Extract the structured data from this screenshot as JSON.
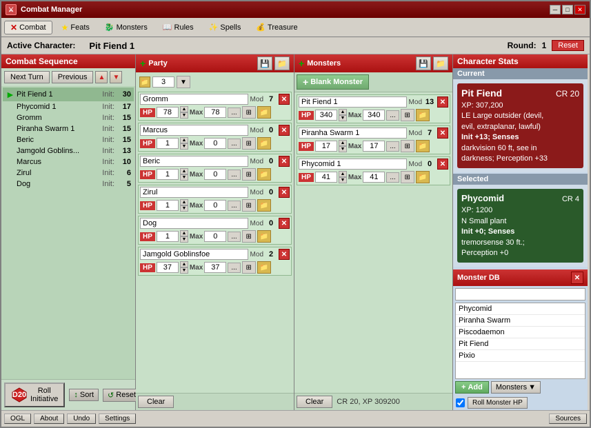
{
  "window": {
    "title": "Combat Manager",
    "close": "✕",
    "minimize": "─",
    "maximize": "□"
  },
  "menu": {
    "items": [
      {
        "id": "combat",
        "label": "Combat",
        "icon": "✕",
        "active": true
      },
      {
        "id": "feats",
        "label": "Feats",
        "icon": "★"
      },
      {
        "id": "monsters",
        "label": "Monsters",
        "icon": "👾"
      },
      {
        "id": "rules",
        "label": "Rules",
        "icon": "📖"
      },
      {
        "id": "spells",
        "label": "Spells",
        "icon": "✨"
      },
      {
        "id": "treasure",
        "label": "Treasure",
        "icon": "💰"
      }
    ]
  },
  "active_character": {
    "label": "Active Character:",
    "name": "Pit Fiend 1",
    "round_label": "Round:",
    "round": "1",
    "reset": "Reset"
  },
  "combat_sequence": {
    "header": "Combat Sequence",
    "next_turn": "Next Turn",
    "previous": "Previous",
    "entries": [
      {
        "name": "Pit Fiend 1",
        "init_label": "Init:",
        "init": 30,
        "active": true
      },
      {
        "name": "Phycomid 1",
        "init_label": "Init:",
        "init": 17,
        "active": false
      },
      {
        "name": "Gromm",
        "init_label": "Init:",
        "init": 15,
        "active": false
      },
      {
        "name": "Piranha Swarm 1",
        "init_label": "Init:",
        "init": 15,
        "active": false
      },
      {
        "name": "Beric",
        "init_label": "Init:",
        "init": 15,
        "active": false
      },
      {
        "name": "Jamgold Goblins...",
        "init_label": "Init:",
        "init": 13,
        "active": false
      },
      {
        "name": "Marcus",
        "init_label": "Init:",
        "init": 10,
        "active": false
      },
      {
        "name": "Zirul",
        "init_label": "Init:",
        "init": 6,
        "active": false
      },
      {
        "name": "Dog",
        "init_label": "Init:",
        "init": 5,
        "active": false
      }
    ],
    "roll_initiative": "Roll\nInitiative",
    "sort": "Sort",
    "reset_init": "Reset"
  },
  "party": {
    "header": "Party",
    "entries": [
      {
        "name": "Gromm",
        "mod": 7,
        "hp": 78,
        "max": 78
      },
      {
        "name": "Marcus",
        "mod": 0,
        "hp": 1,
        "max": 0
      },
      {
        "name": "Beric",
        "mod": 0,
        "hp": 1,
        "max": 0
      },
      {
        "name": "Zirul",
        "mod": 0,
        "hp": 1,
        "max": 0
      },
      {
        "name": "Dog",
        "mod": 0,
        "hp": 1,
        "max": 0
      },
      {
        "name": "Jamgold Goblinsfoe",
        "mod": 2,
        "hp": 37,
        "max": 37
      }
    ],
    "init_val": "3",
    "clear": "Clear"
  },
  "monsters": {
    "header": "Monsters",
    "blank_monster": "Blank Monster",
    "entries": [
      {
        "name": "Pit Fiend 1",
        "mod": 13,
        "hp": 340,
        "max": 340
      },
      {
        "name": "Piranha Swarm 1",
        "mod": 7,
        "hp": 17,
        "max": 17
      },
      {
        "name": "Phycomid 1",
        "mod": 0,
        "hp": 41,
        "max": 41
      }
    ],
    "clear": "Clear",
    "cr_xp": "CR 20, XP 309200"
  },
  "character_stats": {
    "header": "Character Stats",
    "current_label": "Current",
    "current": {
      "name": "Pit Fiend",
      "cr": "CR 20",
      "xp": "XP: 307,200",
      "alignment": "LE Large outsider (devil,",
      "alignment2": "evil, extraplanar, lawful)",
      "init": "Init +13; Senses",
      "senses": "darkvision 60 ft, see in",
      "senses2": "darkness; Perception +33"
    },
    "selected_label": "Selected",
    "selected": {
      "name": "Phycomid",
      "cr": "CR 4",
      "xp": "XP: 1200",
      "type": "N Small plant",
      "init": "Init +0; Senses",
      "senses": "tremorsense 30 ft.;",
      "senses2": "Perception +0"
    },
    "monster_db_label": "Monster DB",
    "db_items": [
      "Phycomid",
      "Piranha Swarm",
      "Piscodaemon",
      "Pit Fiend",
      "Pixio"
    ],
    "add": "Add",
    "monsters_dropdown": "Monsters",
    "roll_monster_hp": "Roll Monster HP"
  },
  "status_bar": {
    "ogl": "OGL",
    "about": "About",
    "undo": "Undo",
    "settings": "Settings",
    "sources": "Sources",
    "roll_monster": "Roll Monster"
  }
}
